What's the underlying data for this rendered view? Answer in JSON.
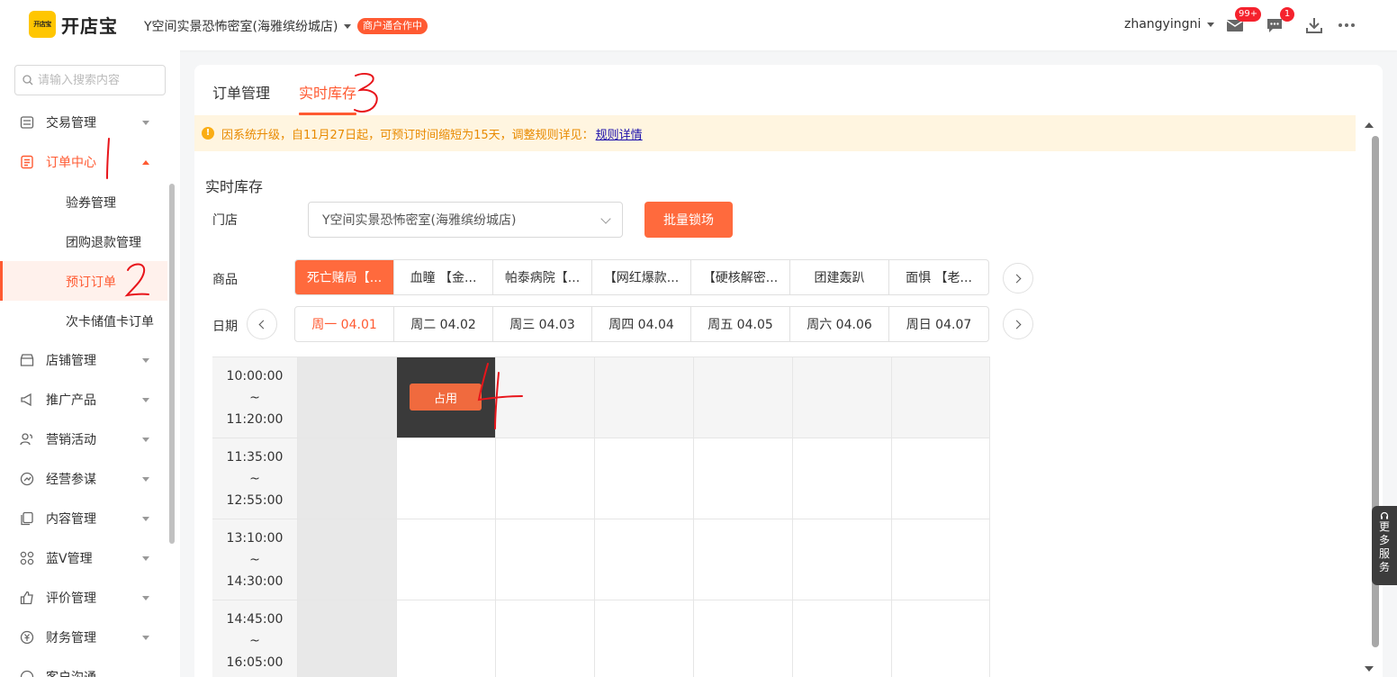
{
  "header": {
    "logo_mark": "开店宝",
    "logo_text": "开店宝",
    "store_name": "Y空间实景恐怖密室(海雅缤纷城店)",
    "coop_badge": "商户通合作中",
    "user_name": "zhangyingni",
    "mail_badge": "99+",
    "chat_badge": "1",
    "icons": [
      "mail-icon",
      "chat-icon",
      "download-icon",
      "more-icon"
    ]
  },
  "sidebar": {
    "search_placeholder": "请输入搜索内容",
    "items": [
      {
        "label": "交易管理",
        "icon": "transaction-icon"
      },
      {
        "label": "订单中心",
        "icon": "order-icon",
        "open": true
      },
      {
        "label": "店铺管理",
        "icon": "store-icon"
      },
      {
        "label": "推广产品",
        "icon": "promote-icon"
      },
      {
        "label": "营销活动",
        "icon": "marketing-icon"
      },
      {
        "label": "经营参谋",
        "icon": "analysis-icon"
      },
      {
        "label": "内容管理",
        "icon": "content-icon"
      },
      {
        "label": "蓝V管理",
        "icon": "bluev-icon"
      },
      {
        "label": "评价管理",
        "icon": "review-icon"
      },
      {
        "label": "财务管理",
        "icon": "finance-icon"
      },
      {
        "label": "客户沟通",
        "icon": "customer-icon"
      }
    ],
    "sub_items": [
      {
        "label": "验券管理"
      },
      {
        "label": "团购退款管理"
      },
      {
        "label": "预订订单",
        "active": true
      },
      {
        "label": "次卡储值卡订单"
      }
    ]
  },
  "tabs": [
    {
      "label": "订单管理"
    },
    {
      "label": "实时库存",
      "active": true
    }
  ],
  "notice": {
    "text": "因系统升级，自11月27日起，可预订时间缩短为15天，调整规则详见：",
    "link": "规则详情"
  },
  "section_title": "实时库存",
  "store_row": {
    "label": "门店",
    "value": "Y空间实景恐怖密室(海雅缤纷城店)",
    "button": "批量锁场"
  },
  "product_row": {
    "label": "商品",
    "items": [
      "死亡赌局【...",
      "血瞳 【金...",
      "帕泰病院【...",
      "【网红爆款...",
      "【硬核解密...",
      "团建轰趴",
      "面惧 【老..."
    ]
  },
  "date_row": {
    "label": "日期",
    "items": [
      "周一 04.01",
      "周二 04.02",
      "周三 04.03",
      "周四 04.04",
      "周五 04.05",
      "周六 04.06",
      "周日 04.07"
    ]
  },
  "slots": [
    {
      "start": "10:00:00",
      "sep": "~",
      "end": "11:20:00"
    },
    {
      "start": "11:35:00",
      "sep": "~",
      "end": "12:55:00"
    },
    {
      "start": "13:10:00",
      "sep": "~",
      "end": "14:30:00"
    },
    {
      "start": "14:45:00",
      "sep": "~",
      "end": "16:05:00"
    }
  ],
  "occupied_label": "占用",
  "float_service": [
    "更",
    "多",
    "服",
    "务"
  ],
  "colors": {
    "accent": "#ff5a32",
    "button": "#ff6a3d",
    "occupied_cell": "#3a3a3a",
    "annotation": "#e8151b"
  }
}
